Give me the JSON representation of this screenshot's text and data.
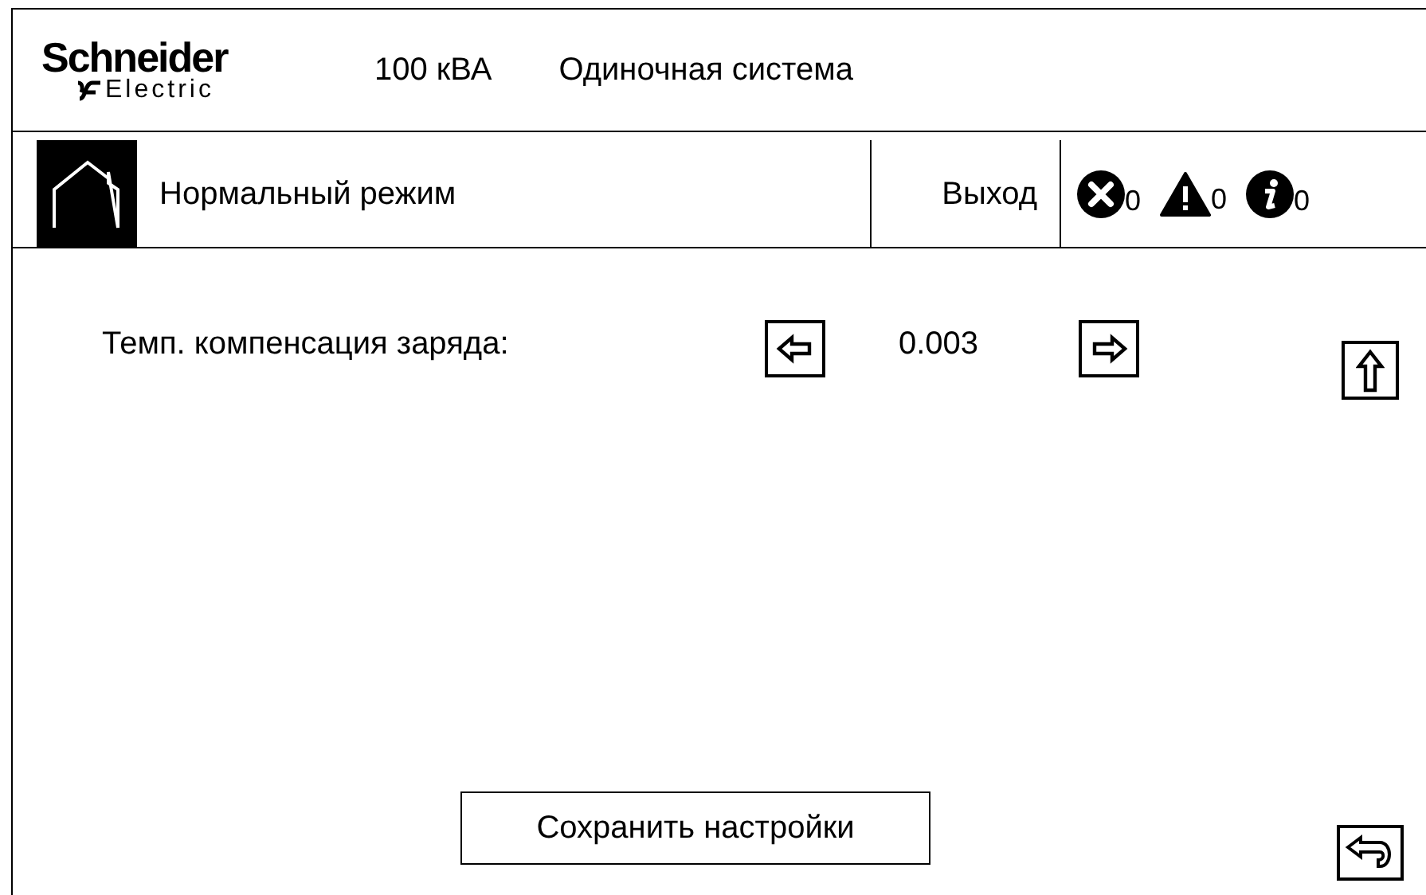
{
  "logo": {
    "brand": "Schneider",
    "sub": "Electric"
  },
  "header": {
    "rating": "100 кВА",
    "system": "Одиночная система"
  },
  "status_bar": {
    "mode": "Нормальный режим",
    "logout": "Выход",
    "alarms": [
      {
        "kind": "error",
        "count": "0"
      },
      {
        "kind": "warning",
        "count": "0"
      },
      {
        "kind": "info",
        "count": "0"
      }
    ]
  },
  "setting": {
    "label": "Темп. компенсация заряда:",
    "value": "0.003"
  },
  "save_button": "Сохранить настройки"
}
